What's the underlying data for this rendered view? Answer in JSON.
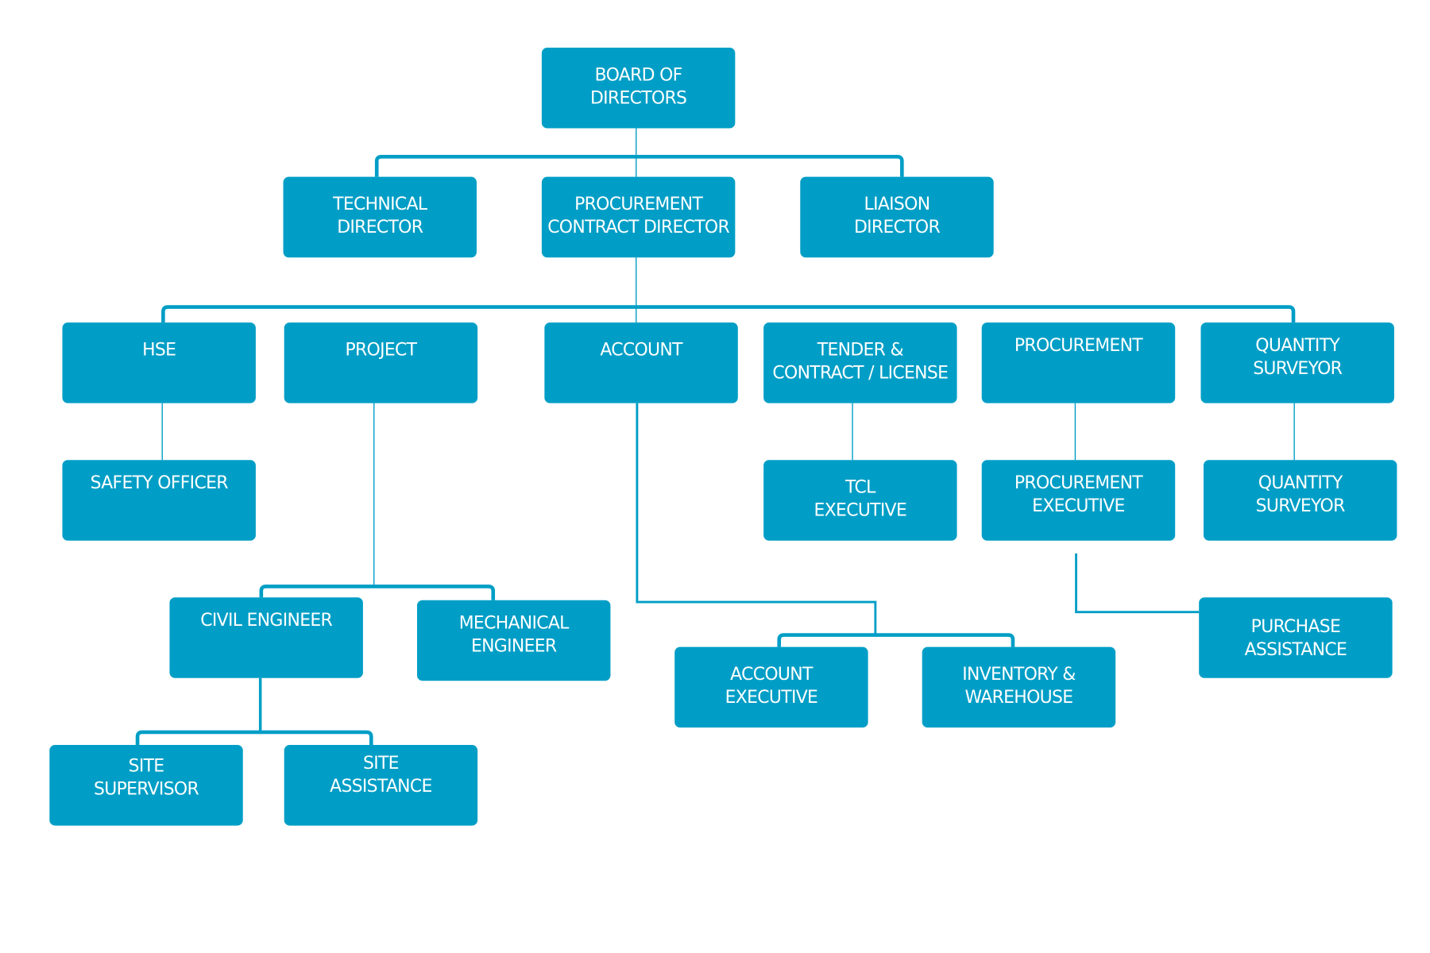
{
  "colors": {
    "box": "#009ec6",
    "line": "#009ec6",
    "text": "#ffffff"
  },
  "nodes": {
    "board": [
      "BOARD OF",
      "DIRECTORS"
    ],
    "technical": [
      "TECHNICAL",
      "DIRECTOR"
    ],
    "procurement_contract": [
      "PROCUREMENT",
      "CONTRACT DIRECTOR"
    ],
    "liaison": [
      "LIAISON",
      "DIRECTOR"
    ],
    "hse": [
      "HSE"
    ],
    "project": [
      "PROJECT"
    ],
    "account": [
      "ACCOUNT"
    ],
    "tender": [
      "TENDER &",
      "CONTRACT / LICENSE"
    ],
    "procurement": [
      "PROCUREMENT"
    ],
    "quantity_surveyor": [
      "QUANTITY",
      "SURVEYOR"
    ],
    "safety_officer": [
      "SAFETY OFFICER"
    ],
    "tcl_executive": [
      "TCL",
      "EXECUTIVE"
    ],
    "procurement_executive": [
      "PROCUREMENT",
      "EXECUTIVE"
    ],
    "quantity_surveyor_2": [
      "QUANTITY",
      "SURVEYOR"
    ],
    "civil_engineer": [
      "CIVIL ENGINEER"
    ],
    "mechanical_engineer": [
      "MECHANICAL",
      "ENGINEER"
    ],
    "account_executive": [
      "ACCOUNT",
      "EXECUTIVE"
    ],
    "inventory": [
      "INVENTORY &",
      "WAREHOUSE"
    ],
    "purchase_assistance": [
      "PURCHASE",
      "ASSISTANCE"
    ],
    "site_supervisor": [
      "SITE",
      "SUPERVISOR"
    ],
    "site_assistance": [
      "SITE",
      "ASSISTANCE"
    ]
  }
}
